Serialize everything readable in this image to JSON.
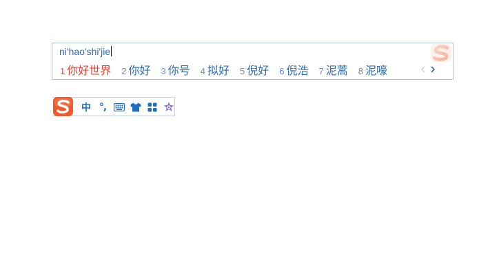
{
  "ime": {
    "composition": "ni'hao'shi'jie",
    "candidates": [
      {
        "num": "1",
        "text": "你好世界"
      },
      {
        "num": "2",
        "text": "你好"
      },
      {
        "num": "3",
        "text": "你号"
      },
      {
        "num": "4",
        "text": "拟好"
      },
      {
        "num": "5",
        "text": "倪好"
      },
      {
        "num": "6",
        "text": "倪浩"
      },
      {
        "num": "7",
        "text": "泥蒿"
      },
      {
        "num": "8",
        "text": "泥嚎"
      }
    ],
    "skin_logo_icon": "sogou-logo-watermark-icon"
  },
  "status_bar": {
    "logo_icon": "sogou-logo-icon",
    "mode_label": "中",
    "punct_label": "°,",
    "items": [
      "keyboard-icon",
      "tshirt-skin-icon",
      "toolbox-grid-icon",
      "settings-star-icon"
    ]
  },
  "colors": {
    "accent": "#2e6db4",
    "active": "#e8412f",
    "status_blue": "#1e6fc2",
    "logo_orange": "#f05a28",
    "border": "#a9c4dd"
  }
}
